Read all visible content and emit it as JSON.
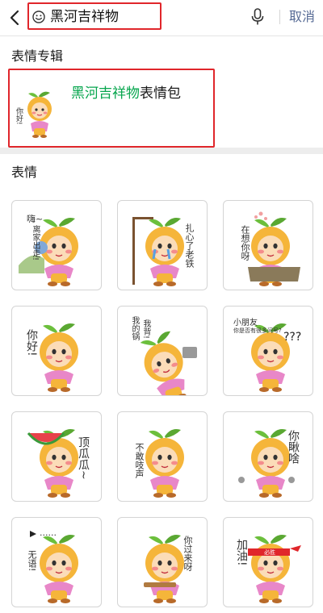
{
  "search": {
    "value": "黑河吉祥物",
    "cancel_label": "取消"
  },
  "album_section": {
    "title": "表情专辑",
    "album": {
      "name_highlight": "黑河吉祥物",
      "name_rest": "表情包",
      "thumb_caption": "你好!"
    }
  },
  "sticker_section": {
    "title": "表情",
    "stickers": [
      {
        "caption_1": "嗨~",
        "caption_2": "离家出走!"
      },
      {
        "caption_1": "扎心了老铁"
      },
      {
        "caption_1": "在想你呀"
      },
      {
        "caption_1": "你好!"
      },
      {
        "caption_1": "我的锅",
        "caption_2": "我背!"
      },
      {
        "caption_1": "小朋友",
        "caption_2": "你是否有很多问号?",
        "caption_3": "???"
      },
      {
        "caption_1": "顶瓜瓜~"
      },
      {
        "caption_1": "不敢吱声"
      },
      {
        "caption_1": "你瞅啥"
      },
      {
        "caption_1": "无语!",
        "caption_2": "......"
      },
      {
        "caption_1": "你过来呀"
      },
      {
        "caption_1": "加油!",
        "caption_2": "必胜"
      }
    ]
  },
  "colors": {
    "highlight_border": "#e0262b",
    "album_highlight": "#07a64e",
    "cancel": "#576b95",
    "mascot_body": "#f5b53a",
    "mascot_leaf": "#5aa832"
  }
}
